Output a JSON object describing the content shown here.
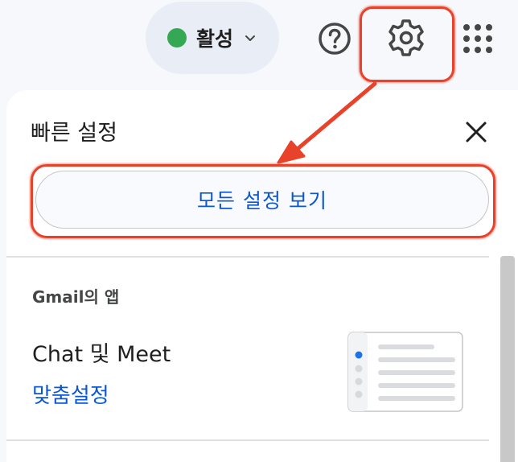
{
  "topbar": {
    "status_label": "활성",
    "status_color": "#34a853",
    "icons": [
      "help-icon",
      "gear-icon",
      "apps-grid-icon",
      "chevron-down-icon"
    ]
  },
  "quick_settings": {
    "title": "빠른 설정",
    "close_icon": "close-icon",
    "all_settings_label": "모든 설정 보기"
  },
  "apps_section": {
    "heading": "Gmail의 앱",
    "item_title": "Chat 및 Meet",
    "item_link": "맞춤설정"
  },
  "colors": {
    "accent": "#0b57d0",
    "annotation": "#e8432a",
    "background": "#f6f8fc"
  }
}
